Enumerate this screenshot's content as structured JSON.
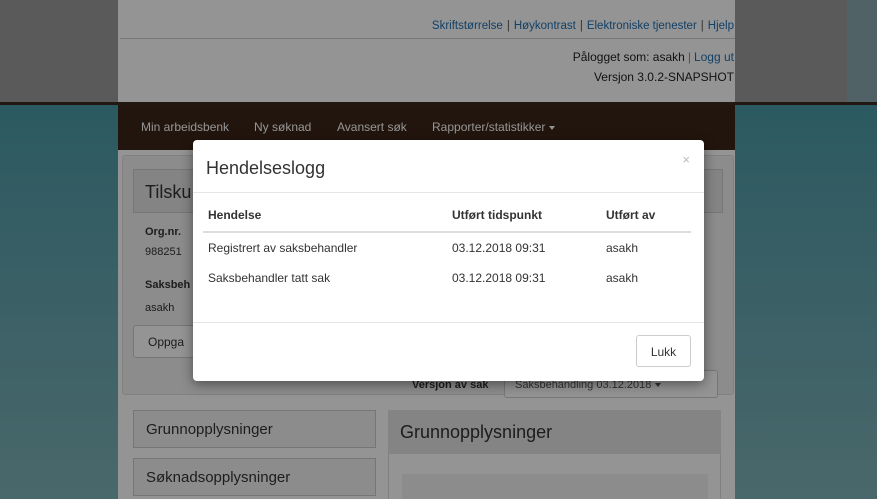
{
  "header": {
    "links": [
      "Skriftstørrelse",
      "Høykontrast",
      "Elektroniske tjenester",
      "Hjelp"
    ],
    "logged_in_label": "Pålogget som: asakh",
    "logout": "Logg ut",
    "version": "Versjon 3.0.2-SNAPSHOT"
  },
  "nav": {
    "items": [
      "Min arbeidsbenk",
      "Ny søknad",
      "Avansert søk",
      "Rapporter/statistikker"
    ]
  },
  "background_page": {
    "title": "Tilsku",
    "orgnr_label": "Org.nr.",
    "orgnr_value": "988251",
    "saksbehandler_label": "Saksbeh",
    "saksbehandler_value": "asakh",
    "oppgave_button": "Oppga",
    "versjon_label": "Versjon av sak",
    "versjon_select": "Saksbehandling 03.12.2018",
    "sidebar": [
      "Grunnopplysninger",
      "Søknadsopplysninger"
    ],
    "main_title": "Grunnopplysninger"
  },
  "modal": {
    "title": "Hendelseslogg",
    "close_glyph": "×",
    "columns": [
      "Hendelse",
      "Utført tidspunkt",
      "Utført av"
    ],
    "rows": [
      [
        "Registrert av saksbehandler",
        "03.12.2018 09:31",
        "asakh"
      ],
      [
        "Saksbehandler tatt sak",
        "03.12.2018 09:31",
        "asakh"
      ]
    ],
    "close_button": "Lukk"
  }
}
